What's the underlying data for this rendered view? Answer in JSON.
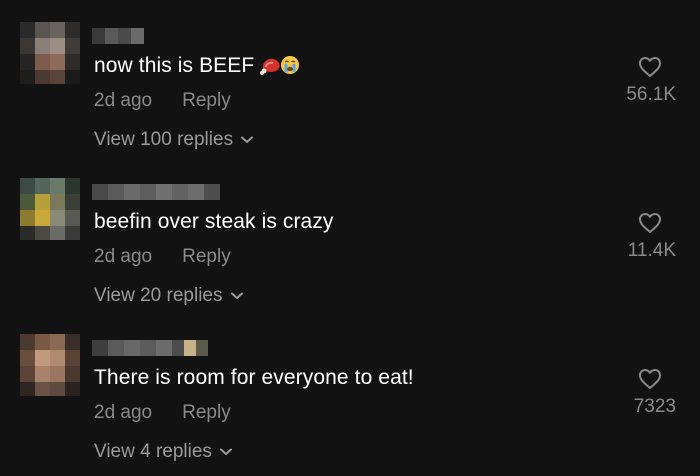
{
  "comments": [
    {
      "text": "now this is BEEF",
      "emojis": [
        "meat-emoji",
        "crying-face-emoji"
      ],
      "time": "2d ago",
      "reply_label": "Reply",
      "view_replies": "View 100 replies",
      "like_count": "56.1K"
    },
    {
      "text": "beefin over steak is crazy",
      "emojis": [],
      "time": "2d ago",
      "reply_label": "Reply",
      "view_replies": "View 20 replies",
      "like_count": "11.4K"
    },
    {
      "text": "There is room for everyone to eat!",
      "emojis": [],
      "time": "2d ago",
      "reply_label": "Reply",
      "view_replies": "View 4 replies",
      "like_count": "7323"
    }
  ],
  "colors": {
    "background": "#121212",
    "primary_text": "#ffffff",
    "secondary_text": "#8a8a8a"
  },
  "icons": {
    "like": "heart-outline-icon",
    "expand": "chevron-down-icon"
  }
}
